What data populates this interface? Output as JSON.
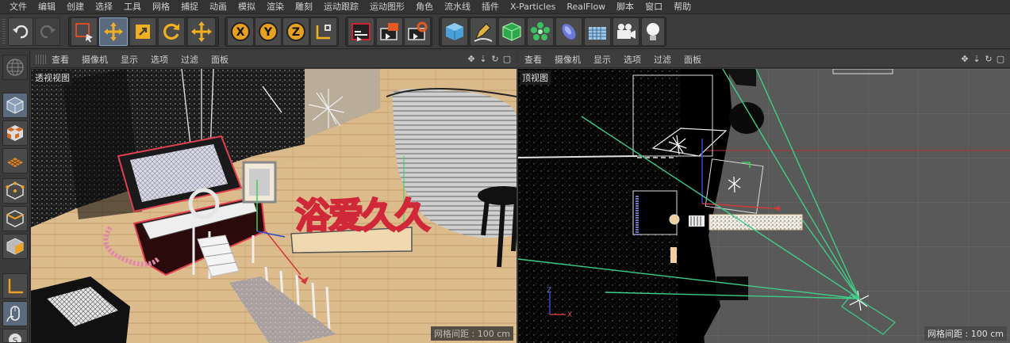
{
  "menu": [
    "文件",
    "编辑",
    "创建",
    "选择",
    "工具",
    "网格",
    "捕捉",
    "动画",
    "模拟",
    "渲染",
    "雕刻",
    "运动跟踪",
    "运动图形",
    "角色",
    "流水线",
    "插件",
    "X-Particles",
    "RealFlow",
    "脚本",
    "窗口",
    "帮助"
  ],
  "toolbar": {
    "icons": [
      "undo-icon",
      "redo-icon",
      "live-select-icon",
      "move-icon",
      "scale-icon",
      "rotate-icon",
      "move-icon-2",
      "x-axis-icon",
      "y-axis-icon",
      "z-axis-icon",
      "coordinate-system-icon",
      "render-view-icon",
      "render-picture-viewer-icon",
      "render-settings-icon",
      "cube-icon",
      "pen-icon",
      "subdivision-icon",
      "cloner-icon",
      "deformer-icon",
      "floor-icon",
      "camera-icon",
      "light-icon"
    ],
    "axis_x": "X",
    "axis_y": "Y",
    "axis_z": "Z"
  },
  "left_viewport": {
    "menu": [
      "查看",
      "摄像机",
      "显示",
      "选项",
      "过滤",
      "面板"
    ],
    "label": "透视视图",
    "grid_spacing": "网格间距 : 100 cm",
    "neon_text": "浴爱久久"
  },
  "right_viewport": {
    "menu": [
      "查看",
      "摄像机",
      "显示",
      "选项",
      "过滤",
      "面板"
    ],
    "label": "顶视图",
    "grid_spacing": "网格间距 : 100 cm",
    "axis_z": "Z",
    "axis_x": "X"
  },
  "colors": {
    "accent_blue": "#5b8fd6",
    "axis_red": "#d03a3a",
    "axis_green": "#3ccf5a",
    "camera_line": "#3ecf88",
    "floor_wood": "#d9b88a"
  }
}
